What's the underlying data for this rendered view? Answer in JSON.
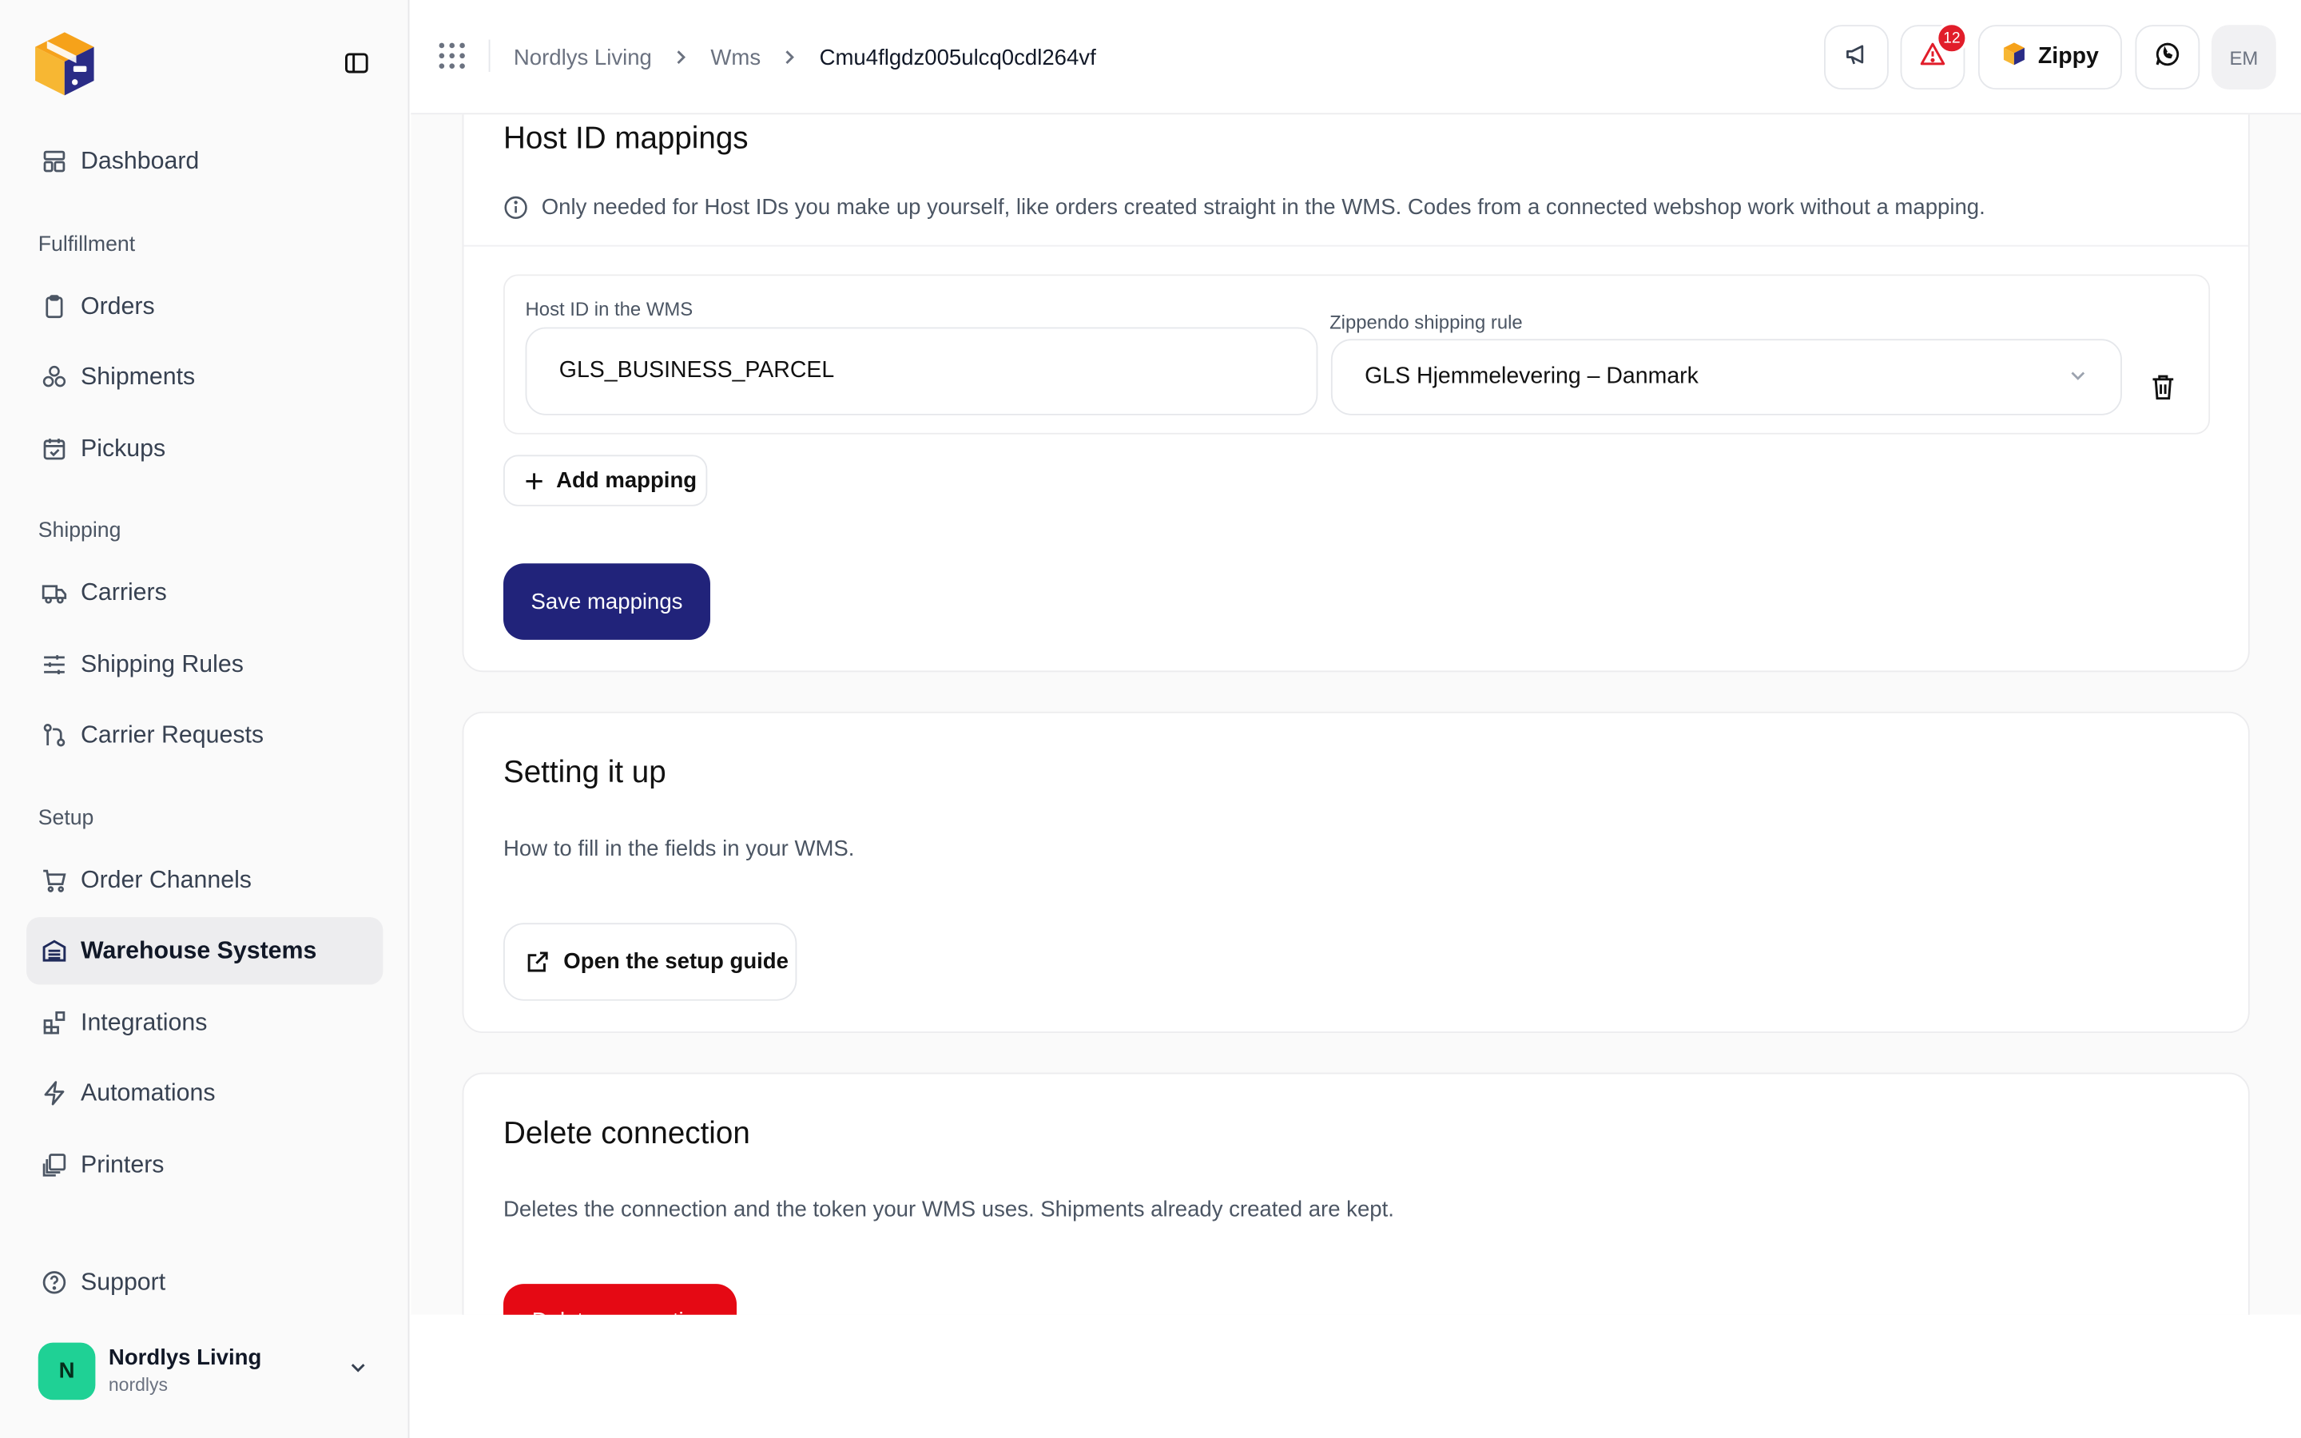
{
  "sidebar": {
    "items": [
      {
        "label": "Dashboard",
        "icon": "dashboard-icon"
      },
      {
        "label": "Orders",
        "icon": "clipboard-icon"
      },
      {
        "label": "Shipments",
        "icon": "boxes-icon"
      },
      {
        "label": "Pickups",
        "icon": "calendar-check-icon"
      },
      {
        "label": "Carriers",
        "icon": "truck-icon"
      },
      {
        "label": "Shipping Rules",
        "icon": "sliders-icon"
      },
      {
        "label": "Carrier Requests",
        "icon": "git-pull-request-icon"
      },
      {
        "label": "Order Channels",
        "icon": "cart-icon"
      },
      {
        "label": "Warehouse Systems",
        "icon": "warehouse-icon",
        "active": true
      },
      {
        "label": "Integrations",
        "icon": "blocks-icon"
      },
      {
        "label": "Automations",
        "icon": "bolt-icon"
      },
      {
        "label": "Printers",
        "icon": "printer-icon"
      },
      {
        "label": "Support",
        "icon": "help-circle-icon"
      }
    ],
    "sections": [
      "Fulfillment",
      "Shipping",
      "Setup"
    ],
    "account": {
      "initial": "N",
      "name": "Nordlys Living",
      "slug": "nordlys"
    }
  },
  "topbar": {
    "breadcrumbs": [
      "Nordlys Living",
      "Wms",
      "Cmu4flgdz005ulcq0cdl264vf"
    ],
    "alerts_count": "12",
    "assistant_label": "Zippy",
    "user_initials": "EM"
  },
  "host_mappings": {
    "title": "Host ID mappings",
    "info": "Only needed for Host IDs you make up yourself, like orders created straight in the WMS. Codes from a connected webshop work without a mapping.",
    "host_id_label": "Host ID in the WMS",
    "host_id_value": "GLS_BUSINESS_PARCEL",
    "rule_label": "Zippendo shipping rule",
    "rule_value": "GLS Hjemmelevering – Danmark",
    "add_label": "Add mapping",
    "save_label": "Save mappings"
  },
  "setup": {
    "title": "Setting it up",
    "desc": "How to fill in the fields in your WMS.",
    "guide_label": "Open the setup guide"
  },
  "delete": {
    "title": "Delete connection",
    "desc": "Deletes the connection and the token your WMS uses. Shipments already created are kept.",
    "button_label": "Delete connection"
  },
  "colors": {
    "primary": "#21237a",
    "danger": "#e50914",
    "badge": "#e11d2a",
    "avatar": "#1fd195"
  }
}
